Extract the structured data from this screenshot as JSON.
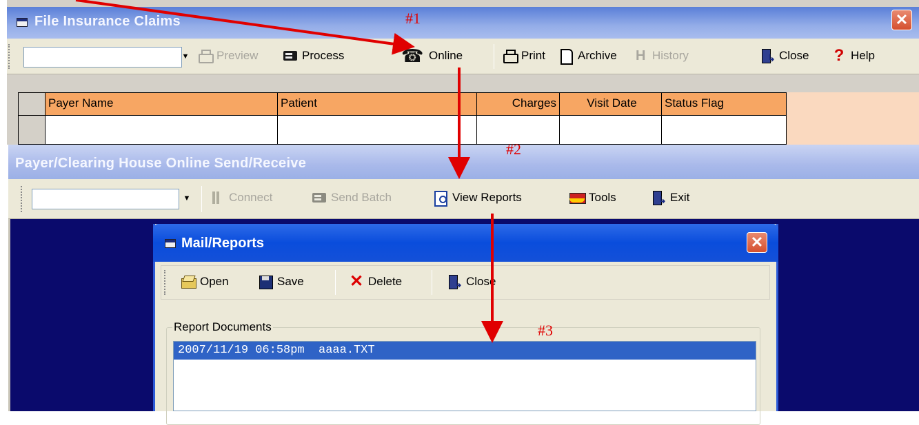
{
  "window1": {
    "title": "File Insurance Claims",
    "close_glyph": "✕",
    "toolbar": {
      "combo_value": "",
      "items": [
        {
          "label": "Preview",
          "icon": "printer-icon",
          "enabled": false
        },
        {
          "label": "Process",
          "icon": "card-icon",
          "enabled": true
        },
        {
          "label": "Online",
          "icon": "telephone-icon",
          "enabled": true
        },
        {
          "label": "Print",
          "icon": "printer-icon",
          "enabled": true
        },
        {
          "label": "Archive",
          "icon": "document-icon",
          "enabled": true
        },
        {
          "label": "History",
          "icon": "history-icon",
          "enabled": false
        },
        {
          "label": "Close",
          "icon": "exit-door-icon",
          "enabled": true
        },
        {
          "label": "Help",
          "icon": "help-icon",
          "enabled": true
        }
      ]
    },
    "grid": {
      "columns": [
        "Payer Name",
        "Patient",
        "Charges",
        "Visit Date",
        "Status Flag"
      ],
      "rows": [
        [
          "",
          "",
          "",
          "",
          ""
        ]
      ]
    }
  },
  "window2": {
    "title": "Payer/Clearing House Online  Send/Receive",
    "toolbar": {
      "combo_value": "",
      "items": [
        {
          "label": "Connect",
          "icon": "connect-icon",
          "enabled": false
        },
        {
          "label": "Send Batch",
          "icon": "card-icon",
          "enabled": false
        },
        {
          "label": "View Reports",
          "icon": "view-reports-icon",
          "enabled": true
        },
        {
          "label": "Tools",
          "icon": "tools-icon",
          "enabled": true
        },
        {
          "label": "Exit",
          "icon": "exit-door-icon",
          "enabled": true
        }
      ]
    }
  },
  "window3": {
    "title": "Mail/Reports",
    "close_glyph": "✕",
    "toolbar": {
      "items": [
        {
          "label": "Open",
          "icon": "open-folder-icon"
        },
        {
          "label": "Save",
          "icon": "save-disk-icon"
        },
        {
          "label": "Delete",
          "icon": "delete-x-icon"
        },
        {
          "label": "Close",
          "icon": "exit-door-icon"
        }
      ]
    },
    "group_label": "Report Documents",
    "documents": [
      {
        "text": "2007/11/19 06:58pm  aaaa.TXT",
        "selected": true
      }
    ]
  },
  "annotations": {
    "labels": [
      "#1",
      "#2",
      "#3"
    ],
    "arrow_color": "#e00000"
  }
}
